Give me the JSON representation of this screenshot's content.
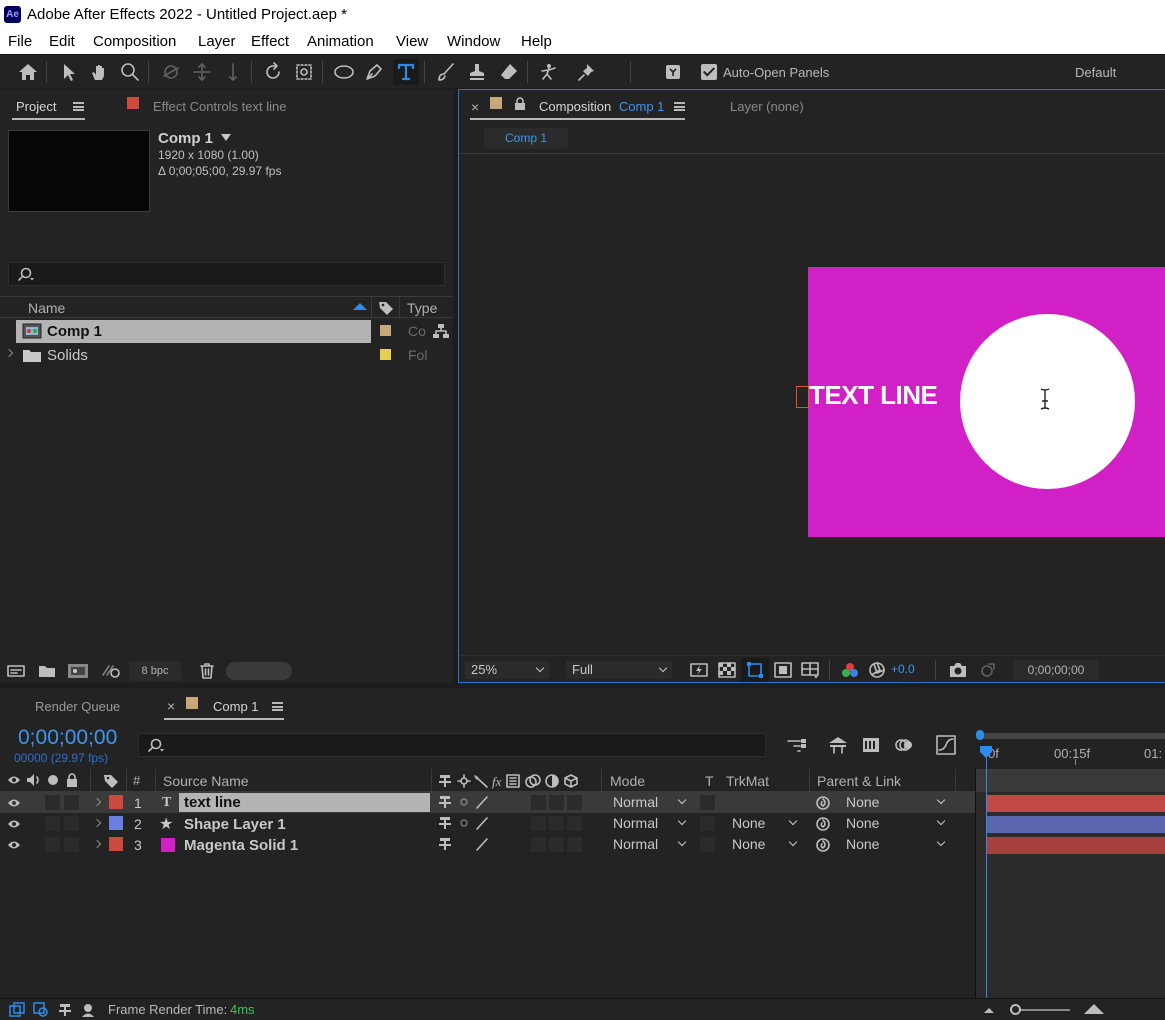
{
  "app": {
    "title": "Adobe After Effects 2022 - Untitled Project.aep *",
    "logo_text": "Ae"
  },
  "menu": [
    "File",
    "Edit",
    "Composition",
    "Layer",
    "Effect",
    "Animation",
    "View",
    "Window",
    "Help"
  ],
  "toolbar": {
    "auto_open_label": "Auto-Open Panels",
    "auto_open_checked": true,
    "workspace": "Default"
  },
  "project_panel": {
    "tab_project": "Project",
    "tab_effect_controls": "Effect Controls",
    "effect_controls_target": "text line",
    "selected_item": {
      "name": "Comp 1",
      "resolution": "1920 x 1080 (1.00)",
      "duration": "Δ 0;00;05;00, 29.97 fps"
    },
    "search_placeholder": "",
    "columns": {
      "name": "Name",
      "type": "Type"
    },
    "items": [
      {
        "name": "Comp 1",
        "type": "Composition",
        "type_short": "Co",
        "label_color": "#c8a87a",
        "selected": true
      },
      {
        "name": "Solids",
        "type": "Folder",
        "type_short": "Fol",
        "label_color": "#e6d14a",
        "selected": false
      }
    ],
    "bit_depth": "8 bpc"
  },
  "comp_viewer": {
    "tab_composition_prefix": "Composition",
    "tab_composition_name": "Comp 1",
    "tab_layer": "Layer (none)",
    "breadcrumb": "Comp 1",
    "canvas_text": "TEXT LINE",
    "canvas_bg": "#d120c6",
    "zoom": "25%",
    "resolution": "Full",
    "exposure": "+0.0",
    "timecode": "0;00;00;00"
  },
  "timeline": {
    "tab_render_queue": "Render Queue",
    "tab_comp": "Comp 1",
    "current_time": "0;00;00;00",
    "frame_info": "00000 (29.97 fps)",
    "columns": {
      "num": "#",
      "source": "Source Name",
      "mode": "Mode",
      "t": "T",
      "trkmat": "TrkMat",
      "parent": "Parent & Link"
    },
    "ruler": [
      "0f",
      "00:15f",
      "01:"
    ],
    "layers": [
      {
        "num": "1",
        "name": "text line",
        "label_color": "#cc4a3b",
        "type_glyph": "T",
        "mode": "Normal",
        "trkmat": "",
        "parent": "None",
        "bar_color": "#c24a44",
        "selected": true
      },
      {
        "num": "2",
        "name": "Shape Layer 1",
        "label_color": "#6b7fe3",
        "type_glyph": "★",
        "mode": "Normal",
        "trkmat": "None",
        "parent": "None",
        "bar_color": "#5a67b0",
        "selected": false
      },
      {
        "num": "3",
        "name": "Magenta Solid 1",
        "label_color": "#cc4a3b",
        "type_glyph": "",
        "swatch": "#d120c6",
        "mode": "Normal",
        "trkmat": "None",
        "parent": "None",
        "bar_color": "#a8403d",
        "selected": false
      }
    ]
  },
  "status": {
    "label": "Frame Render Time:",
    "value": "4ms"
  }
}
